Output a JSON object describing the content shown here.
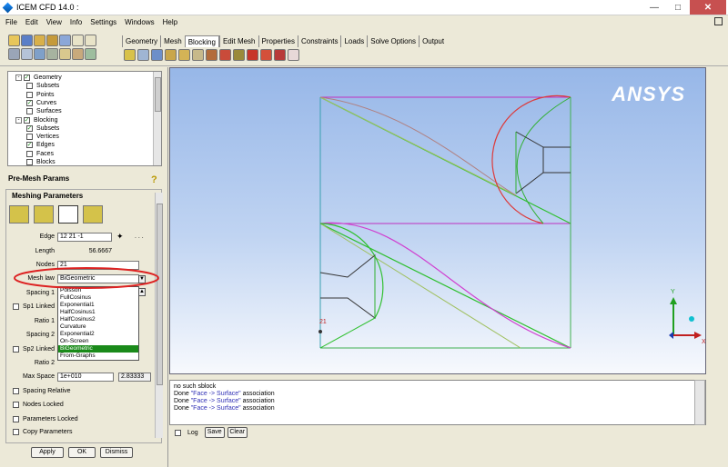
{
  "title": "ICEM CFD 14.0 :",
  "menu": [
    "File",
    "Edit",
    "View",
    "Info",
    "Settings",
    "Windows",
    "Help"
  ],
  "tabs": [
    "Geometry",
    "Mesh",
    "Blocking",
    "Edit Mesh",
    "Properties",
    "Constraints",
    "Loads",
    "Solve Options",
    "Output"
  ],
  "active_tab": "Blocking",
  "tree": {
    "items": [
      {
        "label": "Geometry",
        "level": 0,
        "checked": true,
        "expander": "-"
      },
      {
        "label": "Subsets",
        "level": 1,
        "checked": false
      },
      {
        "label": "Points",
        "level": 1,
        "checked": false
      },
      {
        "label": "Curves",
        "level": 1,
        "checked": true
      },
      {
        "label": "Surfaces",
        "level": 1,
        "checked": false
      },
      {
        "label": "Blocking",
        "level": 0,
        "checked": true,
        "expander": "-"
      },
      {
        "label": "Subsets",
        "level": 1,
        "checked": true
      },
      {
        "label": "Vertices",
        "level": 1,
        "checked": false
      },
      {
        "label": "Edges",
        "level": 1,
        "checked": true
      },
      {
        "label": "Faces",
        "level": 1,
        "checked": false
      },
      {
        "label": "Blocks",
        "level": 1,
        "checked": false
      }
    ]
  },
  "panel": {
    "title": "Pre-Mesh Params",
    "group_title": "Meshing Parameters",
    "edge_label": "Edge",
    "edge_value": "12 21 -1",
    "dots": ". . .",
    "length_label": "Length",
    "length_value": "56.6667",
    "nodes_label": "Nodes",
    "nodes_value": "21",
    "mesh_law_label": "Mesh law",
    "mesh_law_value": "BiGeometric",
    "spacing1_label": "Spacing 1",
    "sp1_linked_label": "Sp1 Linked",
    "ratio1_label": "Ratio 1",
    "spacing2_label": "Spacing 2",
    "sp2_linked_label": "Sp2 Linked",
    "ratio2_label": "Ratio 2",
    "max_space_label": "Max Space",
    "max_space_value": "1e+010",
    "max_space_actual": "2.83333",
    "checkboxes": [
      "Spacing Relative",
      "Nodes Locked",
      "Parameters Locked",
      "Copy Parameters"
    ],
    "buttons": {
      "apply": "Apply",
      "ok": "OK",
      "dismiss": "Dismiss"
    }
  },
  "mesh_law_options": [
    "Poisson",
    "FullCosinus",
    "Exponential1",
    "HalfCosinus1",
    "HalfCosinus2",
    "Curvature",
    "Exponential2",
    "On-Screen",
    "BiGeometric",
    "From-Graphs"
  ],
  "mesh_law_selected_index": 8,
  "viewport": {
    "logo": "ANSYS",
    "vertex_label": "21",
    "axis_y": "Y",
    "axis_x": "X",
    "accent_color": "#dd2222"
  },
  "messages": [
    {
      "text": "no such sblock"
    },
    {
      "prefix": "Done ",
      "quoted": "\"Face -> Surface\"",
      "suffix": " association"
    },
    {
      "prefix": "Done ",
      "quoted": "\"Face -> Surface\"",
      "suffix": " association"
    },
    {
      "prefix": "Done ",
      "quoted": "\"Face -> Surface\"",
      "suffix": " association"
    }
  ],
  "log_bar": {
    "log": "Log",
    "save": "Save",
    "clear": "Clear"
  }
}
